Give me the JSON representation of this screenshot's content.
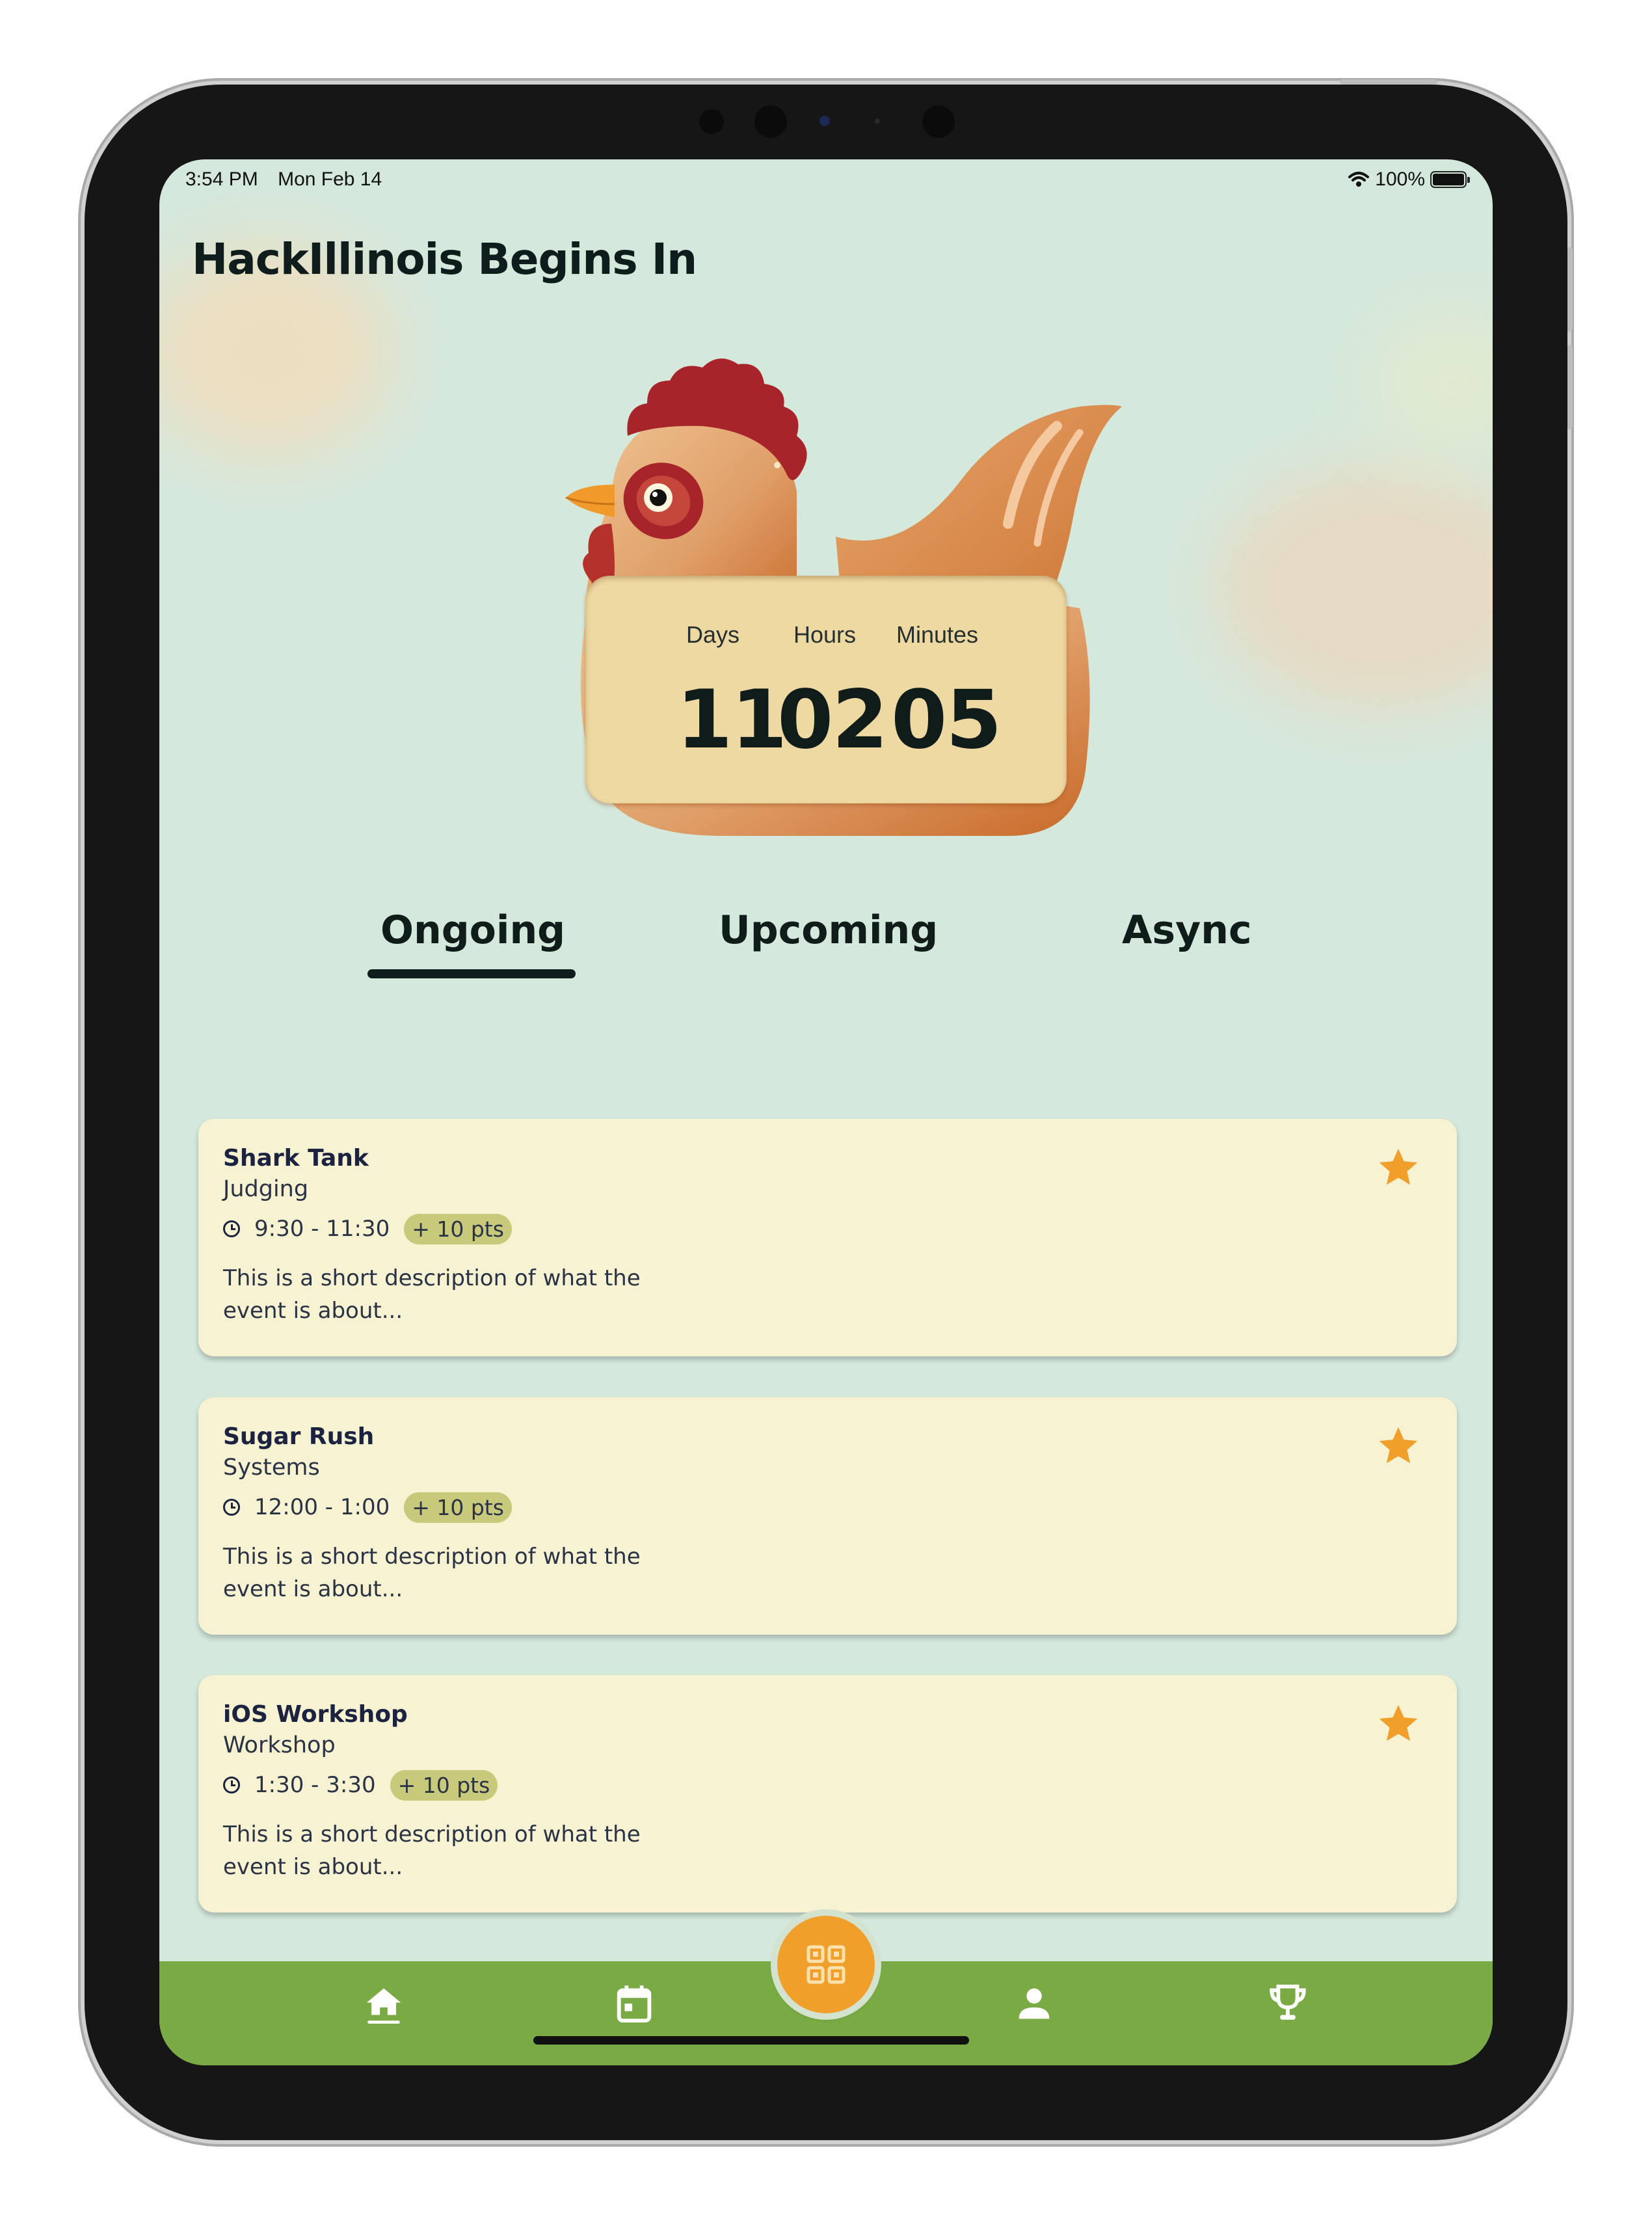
{
  "status_bar": {
    "time": "3:54 PM",
    "date": "Mon Feb 14",
    "battery": "100%"
  },
  "header": {
    "title": "HackIllinois Begins In"
  },
  "countdown": {
    "labels": [
      "Days",
      "Hours",
      "Minutes"
    ],
    "values": [
      "11",
      "02",
      "05"
    ]
  },
  "tabs": [
    {
      "label": "Ongoing",
      "selected": true
    },
    {
      "label": "Upcoming",
      "selected": false
    },
    {
      "label": "Async",
      "selected": false
    }
  ],
  "events": [
    {
      "name": "Shark Tank",
      "type": "Judging",
      "time": "9:30 - 11:30",
      "points": "+ 10 pts",
      "description": "This is a short description of what the event is about..."
    },
    {
      "name": "Sugar Rush",
      "type": "Systems",
      "time": "12:00 - 1:00",
      "points": "+ 10 pts",
      "description": "This is a short description of what the event is about..."
    },
    {
      "name": "iOS Workshop",
      "type": "Workshop",
      "time": "1:30 - 3:30",
      "points": "+ 10 pts",
      "description": "This is a short description of what the event is about..."
    }
  ],
  "nav": {
    "items": [
      "home-icon",
      "calendar-icon",
      "qr-code-icon",
      "profile-icon",
      "trophy-icon"
    ]
  },
  "colors": {
    "background": "#d4e8dc",
    "card": "#f6f2d2",
    "accent": "#f0a02a",
    "nav_bar": "#79aa43",
    "points_badge": "#c8c97a"
  }
}
